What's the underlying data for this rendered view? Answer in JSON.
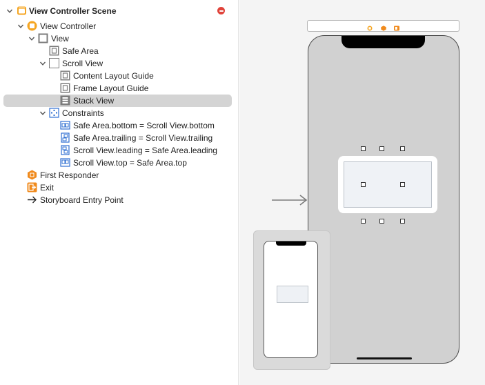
{
  "outline": {
    "rows": [
      {
        "label": "View Controller Scene",
        "bold": true,
        "icon": "scene-icon",
        "chevron": "down"
      },
      {
        "label": "View Controller",
        "icon": "view-controller-icon",
        "chevron": "down"
      },
      {
        "label": "View",
        "icon": "view-icon",
        "chevron": "down"
      },
      {
        "label": "Safe Area",
        "icon": "safe-area-icon",
        "chevron": ""
      },
      {
        "label": "Scroll View",
        "icon": "scroll-view-icon",
        "chevron": "down"
      },
      {
        "label": "Content Layout Guide",
        "icon": "layout-guide-icon",
        "chevron": ""
      },
      {
        "label": "Frame Layout Guide",
        "icon": "layout-guide-icon",
        "chevron": ""
      },
      {
        "label": "Stack View",
        "icon": "stack-view-icon",
        "chevron": "",
        "selected": true
      },
      {
        "label": "Constraints",
        "icon": "constraints-icon",
        "chevron": "down"
      },
      {
        "label": "Safe Area.bottom = Scroll View.bottom",
        "icon": "constraint-icon",
        "chevron": ""
      },
      {
        "label": "Safe Area.trailing = Scroll View.trailing",
        "icon": "constraint-icon",
        "chevron": ""
      },
      {
        "label": "Scroll View.leading = Safe Area.leading",
        "icon": "constraint-icon",
        "chevron": ""
      },
      {
        "label": "Scroll View.top = Safe Area.top",
        "icon": "constraint-icon",
        "chevron": ""
      },
      {
        "label": "First Responder",
        "icon": "first-responder-icon",
        "chevron": ""
      },
      {
        "label": "Exit",
        "icon": "exit-icon",
        "chevron": ""
      },
      {
        "label": "Storyboard Entry Point",
        "icon": "entry-point-arrow-icon",
        "chevron": ""
      }
    ]
  },
  "colors": {
    "accent_orange": "#f5a623",
    "warning_red": "#e0433a",
    "selection_gray": "#d4d4d4",
    "canvas_bg": "#f4f4f4",
    "device_gray": "#d1d1d1"
  }
}
